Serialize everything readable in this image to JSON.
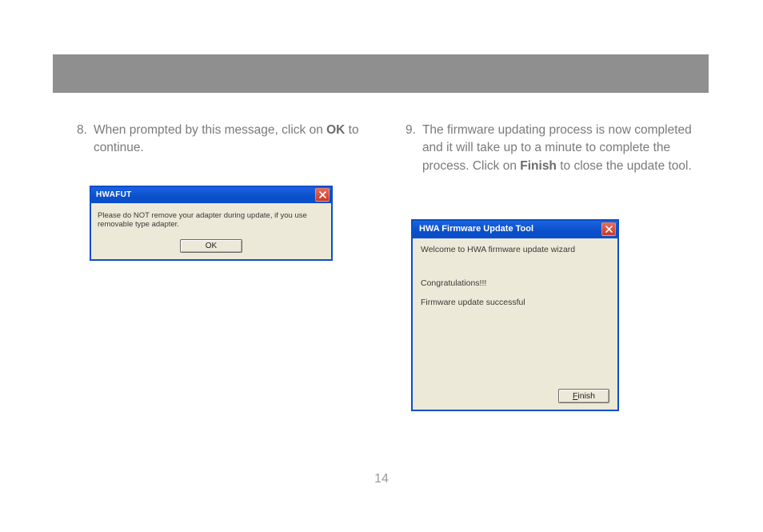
{
  "page_number": "14",
  "step8": {
    "number": "8.",
    "text_before_bold": "When prompted by this message, click on ",
    "bold": "OK",
    "text_after_bold": " to continue."
  },
  "step9": {
    "number": "9.",
    "text_before_bold": "The firmware updating process is now completed and it will take up to a minute to complete the process.  Click on ",
    "bold": "Finish",
    "text_after_bold": " to close the update tool."
  },
  "dialog1": {
    "title": "HWAFUT",
    "message": "Please do NOT remove your adapter during update, if you use removable type adapter.",
    "ok_label": "OK"
  },
  "dialog2": {
    "title": "HWA Firmware Update Tool",
    "welcome": "Welcome to HWA firmware update wizard",
    "congrats": "Congratulations!!!",
    "success": "Firmware update successful",
    "finish_label": "Finish",
    "finish_prefix": "F",
    "finish_rest": "inish"
  }
}
